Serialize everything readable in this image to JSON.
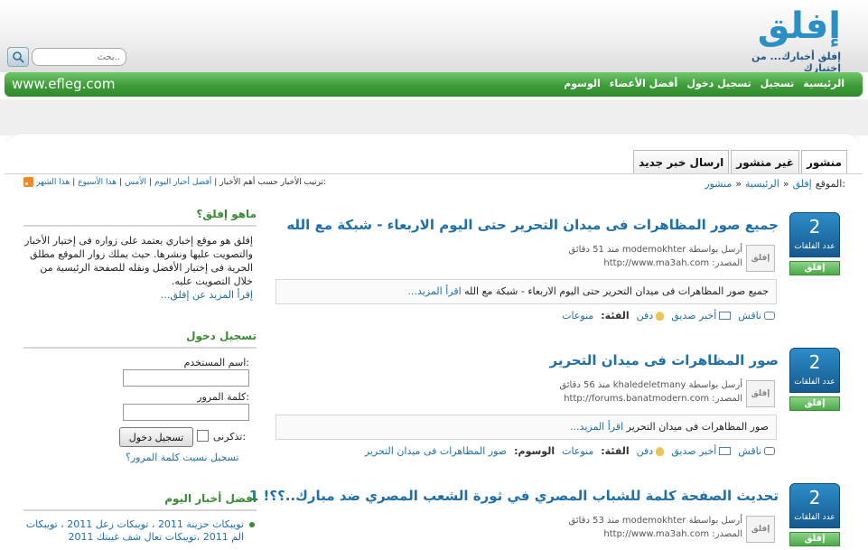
{
  "site": {
    "logo_text": "إفلق",
    "tagline": "إفلق أخبارك... من إختيارك",
    "url_text": "www.efleg.com"
  },
  "search": {
    "placeholder": "بحث.."
  },
  "nav": [
    "الرئيسية",
    "تسجيل",
    "تسجيل دخول",
    "أفضل الأعضاء",
    "الوسوم"
  ],
  "tabs": [
    "منشور",
    "غير منشور",
    "ارسال خبر جديد"
  ],
  "breadcrumb": {
    "label": "الموقع:",
    "items": [
      "إفلق",
      "الرئيسية",
      "منشور"
    ],
    "sep": "»"
  },
  "sort": {
    "label": "ترتيب الأخبار حسب:",
    "options": [
      "أهم الأخبار",
      "أفضل أخبار اليوم",
      "الأمس",
      "هذا الأسبوع",
      "هذا الشهر"
    ],
    "sep": "|"
  },
  "vote": {
    "count_label": "عدد الفلقات",
    "button": "إفلق"
  },
  "avatar_text": "إفلق",
  "meta": {
    "posted_by": "أرسل بواسطة",
    "source": "المصدر:"
  },
  "actions": {
    "discuss": "ناقش",
    "tell_friend": "أخبر صديق",
    "bury": "دفن",
    "category": "الفئة:",
    "tags": "الوسوم:"
  },
  "read_more": "اقرأ المزيد...",
  "news": [
    {
      "votes": "2",
      "title": "جميع صور المظاهرات فى ميدان التحرير حتى اليوم الاربعاء - شبكة مع الله",
      "user": "modemokhter",
      "time": "منذ 51 دقائق",
      "source": "http://www.ma3ah.com",
      "excerpt": "جميع صور المظاهرات فى ميدان التحرير حتى اليوم الاربعاء - شبكة مع الله",
      "category": "منوعات",
      "tags": ""
    },
    {
      "votes": "2",
      "title": "صور المظاهرات فى ميدان التحرير",
      "user": "khaledeletmany",
      "time": "منذ 56 دقائق",
      "source": "http://forums.banatmodern.com",
      "excerpt": "صور المظاهرات فى ميدان التحرير",
      "category": "منوعات",
      "tags": "صور المظاهرات فى ميدان التحرير"
    },
    {
      "votes": "2",
      "title": "تحديث الصفحة كلمة للشباب المصري في ثورة الشعب المصري ضد مبارك..؟؟! 1",
      "user": "modemokhter",
      "time": "منذ 53 دقائق",
      "source": "http://www.ma3ah.com",
      "excerpt": "",
      "category": "",
      "tags": ""
    }
  ],
  "sidebar": {
    "about_title": "ماهو إفلق؟",
    "about_text": "إفلق هو موقع إخباري يعتمد على زواره فى إختيار الأخبار والتصويت عليها ونشرها. حيث يملك زوار الموقع مطلق الحرية فى إختيار الأفضل ونقله للصفحة الرئيسية من خلال التصويت عليه.",
    "about_more": "إقرأ المزيد عن إفلق...",
    "login_title": "تسجيل دخول",
    "username_label": "اسم المستخدم:",
    "password_label": "كلمة المرور:",
    "remember_label": "تذكرنى:",
    "login_button": "تسجيل دخول",
    "links": "تسجيل نسيت كلمة المرور؟",
    "best_title": "أفضل أخبار اليوم",
    "best_item": "تويبكات حزينة 2011 ، تويبكات زعل 2011 ، تويبكات الم 2011 ،تويبكات تعال شف غيبتك 2011"
  }
}
